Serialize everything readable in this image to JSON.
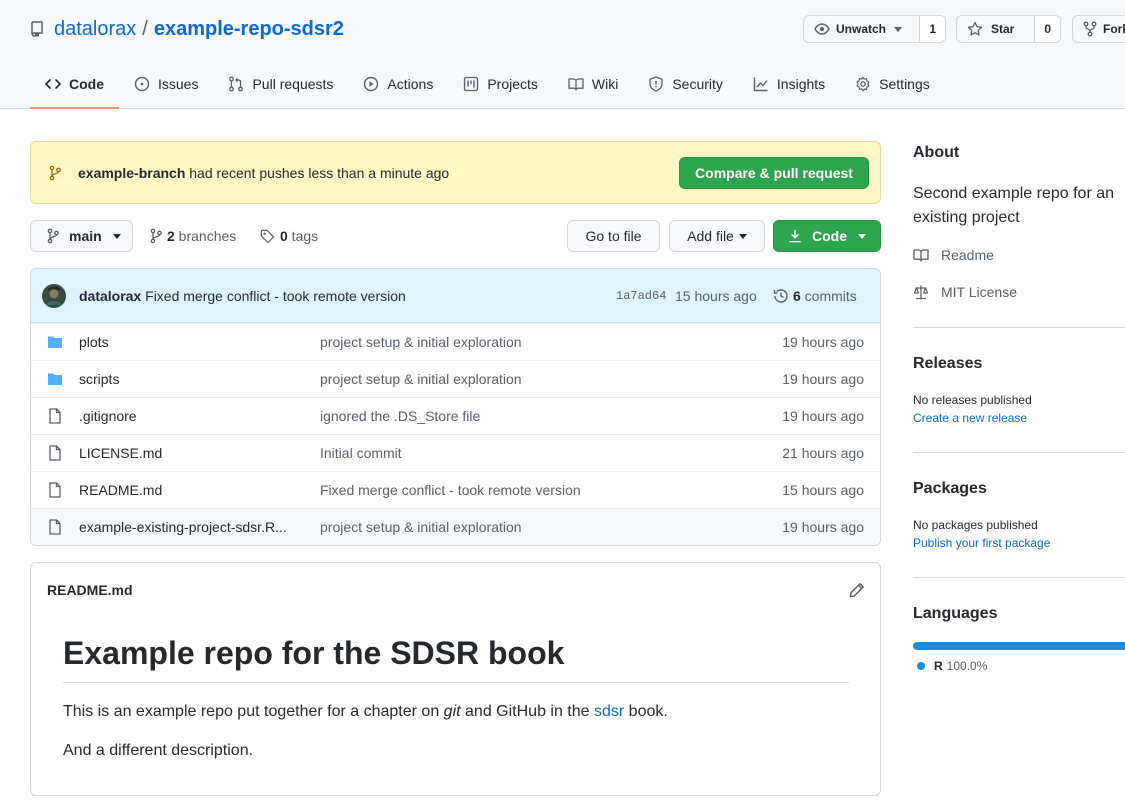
{
  "repo": {
    "owner": "datalorax",
    "separator": "/",
    "name": "example-repo-sdsr2"
  },
  "header_actions": {
    "unwatch_label": "Unwatch",
    "watch_count": "1",
    "star_label": "Star",
    "star_count": "0",
    "fork_label": "Fork"
  },
  "tabs": [
    {
      "label": "Code",
      "icon": "code-icon",
      "active": true
    },
    {
      "label": "Issues",
      "icon": "issue-icon"
    },
    {
      "label": "Pull requests",
      "icon": "pull-request-icon"
    },
    {
      "label": "Actions",
      "icon": "play-icon"
    },
    {
      "label": "Projects",
      "icon": "project-icon"
    },
    {
      "label": "Wiki",
      "icon": "book-icon"
    },
    {
      "label": "Security",
      "icon": "shield-icon"
    },
    {
      "label": "Insights",
      "icon": "graph-icon"
    },
    {
      "label": "Settings",
      "icon": "gear-icon"
    }
  ],
  "banner": {
    "branch": "example-branch",
    "message": " had recent pushes less than a minute ago",
    "button": "Compare & pull request"
  },
  "toolbar": {
    "branch": "main",
    "branches_count": "2",
    "branches_label": " branches",
    "tags_count": "0",
    "tags_label": " tags",
    "go_to_file": "Go to file",
    "add_file": "Add file",
    "code": "Code"
  },
  "latest_commit": {
    "author": "datalorax",
    "message": "Fixed merge conflict - took remote version",
    "sha": "1a7ad64",
    "time": "15 hours ago",
    "commits_count": "6",
    "commits_label": " commits"
  },
  "files": [
    {
      "name": "plots",
      "type": "folder",
      "message": "project setup & initial exploration",
      "age": "19 hours ago"
    },
    {
      "name": "scripts",
      "type": "folder",
      "message": "project setup & initial exploration",
      "age": "19 hours ago"
    },
    {
      "name": ".gitignore",
      "type": "file",
      "message": "ignored the .DS_Store file",
      "age": "19 hours ago"
    },
    {
      "name": "LICENSE.md",
      "type": "file",
      "message": "Initial commit",
      "age": "21 hours ago"
    },
    {
      "name": "README.md",
      "type": "file",
      "message": "Fixed merge conflict - took remote version",
      "age": "15 hours ago"
    },
    {
      "name": "example-existing-project-sdsr.R...",
      "type": "file",
      "message": "project setup & initial exploration",
      "age": "19 hours ago"
    }
  ],
  "readme": {
    "filename": "README.md",
    "heading": "Example repo for the SDSR book",
    "p1_a": "This is an example repo put together for a chapter on ",
    "p1_em": "git",
    "p1_b": " and GitHub in the ",
    "p1_link": "sdsr",
    "p1_c": " book.",
    "p2": "And a different description."
  },
  "about": {
    "title": "About",
    "description": "Second example repo for an existing project",
    "readme_label": "Readme",
    "license_label": "MIT License"
  },
  "releases": {
    "title": "Releases",
    "none": "No releases published",
    "create_link": "Create a new release"
  },
  "packages": {
    "title": "Packages",
    "none": "No packages published",
    "publish_link": "Publish your first package"
  },
  "languages": {
    "title": "Languages",
    "items": [
      {
        "name": "R",
        "percent": "100.0%",
        "fraction": 1.0,
        "color": "#198ce7"
      }
    ]
  },
  "colors": {
    "link": "#0969da",
    "green": "#2da44e",
    "tab_underline": "#fd8c73",
    "banner_bg": "#fff8c5"
  }
}
